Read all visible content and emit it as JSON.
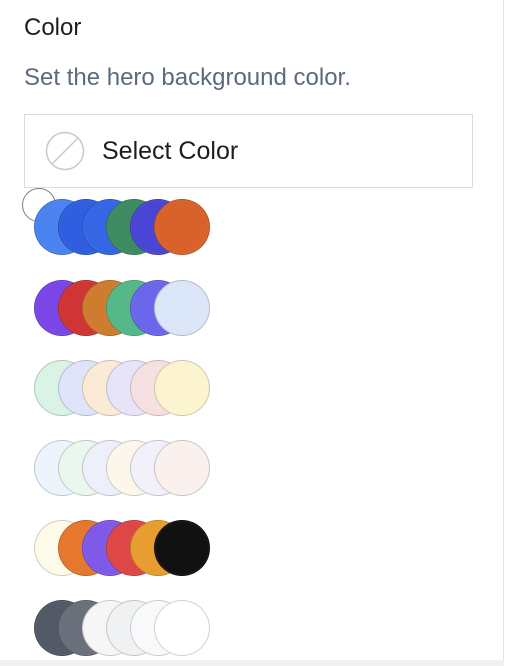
{
  "panel": {
    "title": "Color",
    "help": "Set the hero background color.",
    "select_button_label": "Select Color"
  },
  "icons": {
    "none": "slash-circle-icon",
    "clear": "clear-color-icon"
  },
  "palette_rows": [
    [
      "#4b83f0",
      "#2f5fe0",
      "#3466e6",
      "#3e8a62",
      "#4b45d6",
      "#d9622b"
    ],
    [
      "#7b46e6",
      "#cf3535",
      "#cf7b30",
      "#55b888",
      "#6a67ea",
      "#dbe6f8"
    ],
    [
      "#d9f3e4",
      "#dfe4fa",
      "#fbebd6",
      "#e7e4fa",
      "#f7e0e1",
      "#fcf3cf"
    ],
    [
      "#edf4fc",
      "#e9f7ee",
      "#edf0fb",
      "#fdf6ea",
      "#f1f0fb",
      "#faf0ee"
    ],
    [
      "#fdfaea",
      "#e5772e",
      "#7f5ae8",
      "#dd4747",
      "#e89d31",
      "#111111"
    ],
    [
      "#525a68",
      "#6a707c",
      "#f6f6f6",
      "#f0f1f3",
      "#f8f9fa",
      "#ffffff"
    ]
  ]
}
